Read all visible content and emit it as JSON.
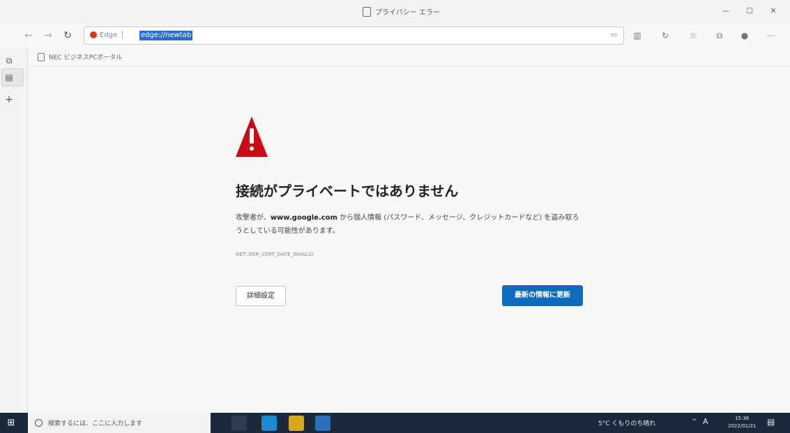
{
  "window": {
    "title": "プライバシー エラー"
  },
  "toolbar": {
    "edge_label": "Edge",
    "url": "edge://newtab"
  },
  "favorites": {
    "items": [
      {
        "label": "NEC ビジネスPCポータル"
      }
    ]
  },
  "error": {
    "heading": "接続がプライベートではありません",
    "desc_part1": "攻撃者が、",
    "desc_domain": "www.google.com",
    "desc_part2": " から個人情報 (パスワード、メッセージ、クレジットカードなど) を盗み取ろうとしている可能性があります。",
    "code": "NET::ERR_CERT_DATE_INVALID",
    "advanced_button": "詳細設定",
    "back_button": "最新の情報に更新"
  },
  "taskbar": {
    "search_placeholder": "検索するには、ここに入力します",
    "weather": "5°C くもりのち晴れ",
    "clock_time": "15:36",
    "clock_date": "2022/01/21"
  },
  "icons": {
    "back": "arrow-left-icon",
    "forward": "arrow-right-icon",
    "refresh": "refresh-icon",
    "warning": "warning-triangle-icon"
  },
  "colors": {
    "warning": "#c70d16",
    "primary_button": "#0f6cbd",
    "url_selection": "#2a6fd0",
    "taskbar": "#1b2a3a"
  }
}
